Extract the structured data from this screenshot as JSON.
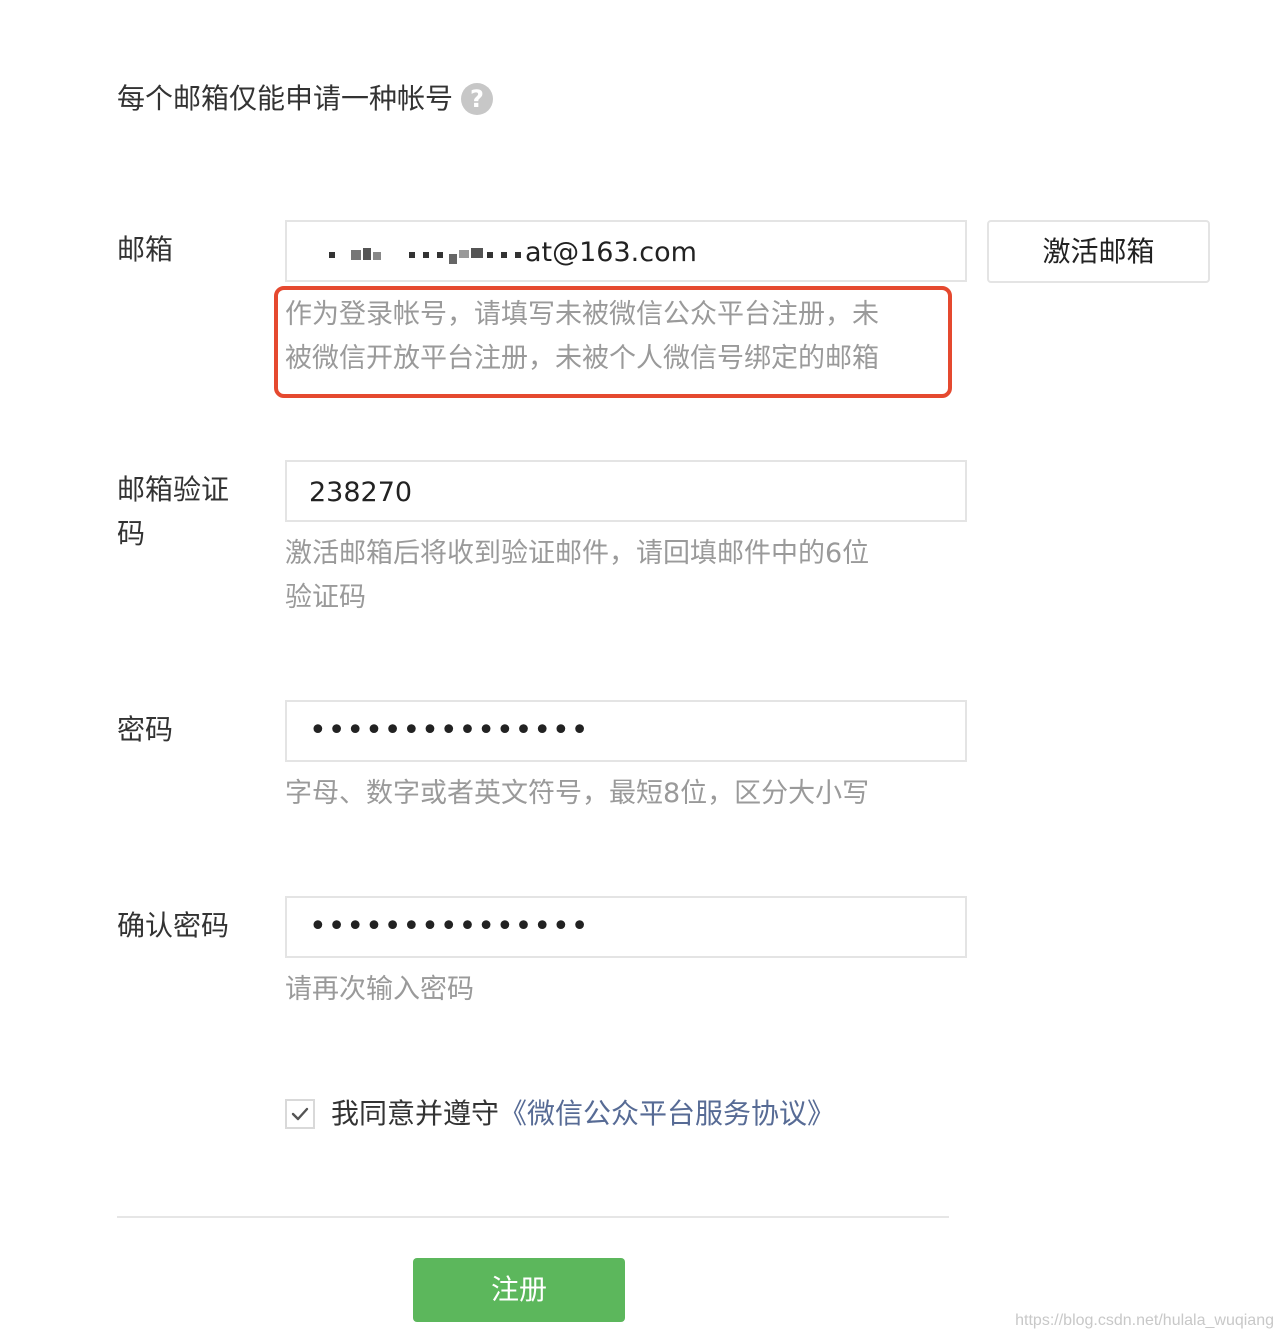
{
  "notice": {
    "text": "每个邮箱仅能申请一种帐号",
    "help_icon": "question-circle-icon",
    "help_glyph": "?"
  },
  "email": {
    "label": "邮箱",
    "value_visible": "at@163.com",
    "value_obscured": true,
    "activate_button": "激活邮箱",
    "hint_line1": "作为登录帐号，请填写未被微信公众平台注册，未",
    "hint_line2": "被微信开放平台注册，未被个人微信号绑定的邮箱",
    "highlight_color": "#e5492f"
  },
  "verify_code": {
    "label_line1": "邮箱验证",
    "label_line2": "码",
    "value": "238270",
    "hint_line1": "激活邮箱后将收到验证邮件，请回填邮件中的6位",
    "hint_line2": "验证码"
  },
  "password": {
    "label": "密码",
    "value_masked": "•••••••••••••••",
    "hint": "字母、数字或者英文符号，最短8位，区分大小写"
  },
  "confirm_password": {
    "label": "确认密码",
    "value_masked": "•••••••••••••••",
    "hint": "请再次输入密码"
  },
  "agreement": {
    "checked": true,
    "text": "我同意并遵守",
    "link": "《微信公众平台服务协议》",
    "link_color": "#576b95"
  },
  "submit": {
    "label": "注册",
    "color": "#5cb75c"
  },
  "watermark": "https://blog.csdn.net/hulala_wuqiang"
}
